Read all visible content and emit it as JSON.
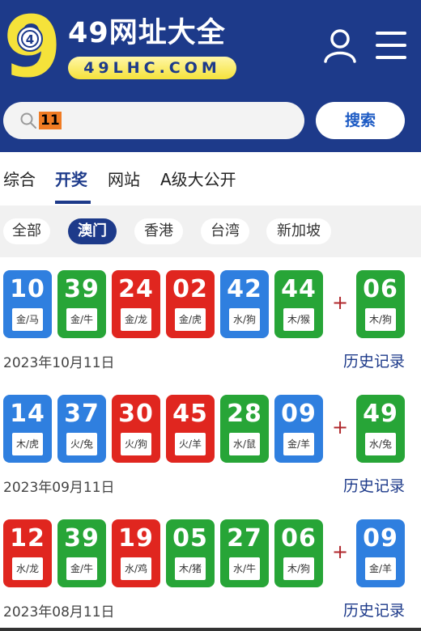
{
  "header": {
    "logo_text": "9",
    "logo_ball": "4",
    "title": "49网址大全",
    "domain": "49LHC.COM",
    "colors": {
      "bg": "#1d3a8a",
      "pill": "#f5e23a"
    },
    "search": {
      "value": "11",
      "button": "搜索"
    }
  },
  "tabs": [
    {
      "label": "综合"
    },
    {
      "label": "开奖",
      "active": true
    },
    {
      "label": "网站"
    },
    {
      "label": "A级大公开"
    }
  ],
  "regions": [
    {
      "label": "全部"
    },
    {
      "label": "澳门",
      "active": true
    },
    {
      "label": "香港"
    },
    {
      "label": "台湾"
    },
    {
      "label": "新加坡"
    }
  ],
  "draws": [
    {
      "balls": [
        {
          "num": "10",
          "tag": "金/马",
          "color": "blue"
        },
        {
          "num": "39",
          "tag": "金/牛",
          "color": "green"
        },
        {
          "num": "24",
          "tag": "金/龙",
          "color": "red"
        },
        {
          "num": "02",
          "tag": "金/虎",
          "color": "red"
        },
        {
          "num": "42",
          "tag": "水/狗",
          "color": "blue"
        },
        {
          "num": "44",
          "tag": "木/猴",
          "color": "green"
        }
      ],
      "special": {
        "num": "06",
        "tag": "木/狗",
        "color": "green"
      },
      "date": "2023年10月11日",
      "history": "历史记录"
    },
    {
      "balls": [
        {
          "num": "14",
          "tag": "木/虎",
          "color": "blue"
        },
        {
          "num": "37",
          "tag": "火/兔",
          "color": "blue"
        },
        {
          "num": "30",
          "tag": "火/狗",
          "color": "red"
        },
        {
          "num": "45",
          "tag": "火/羊",
          "color": "red"
        },
        {
          "num": "28",
          "tag": "水/鼠",
          "color": "green"
        },
        {
          "num": "09",
          "tag": "金/羊",
          "color": "blue"
        }
      ],
      "special": {
        "num": "49",
        "tag": "水/兔",
        "color": "green"
      },
      "date": "2023年09月11日",
      "history": "历史记录"
    },
    {
      "balls": [
        {
          "num": "12",
          "tag": "水/龙",
          "color": "red"
        },
        {
          "num": "39",
          "tag": "金/牛",
          "color": "green"
        },
        {
          "num": "19",
          "tag": "水/鸡",
          "color": "red"
        },
        {
          "num": "05",
          "tag": "木/猪",
          "color": "green"
        },
        {
          "num": "27",
          "tag": "水/牛",
          "color": "green"
        },
        {
          "num": "06",
          "tag": "木/狗",
          "color": "green"
        }
      ],
      "special": {
        "num": "09",
        "tag": "金/羊",
        "color": "blue"
      },
      "date": "2023年08月11日",
      "history": "历史记录"
    }
  ],
  "plus_sign": "+",
  "ball_colors": {
    "red": "#e0261f",
    "blue": "#2f7fdf",
    "green": "#27a537"
  }
}
